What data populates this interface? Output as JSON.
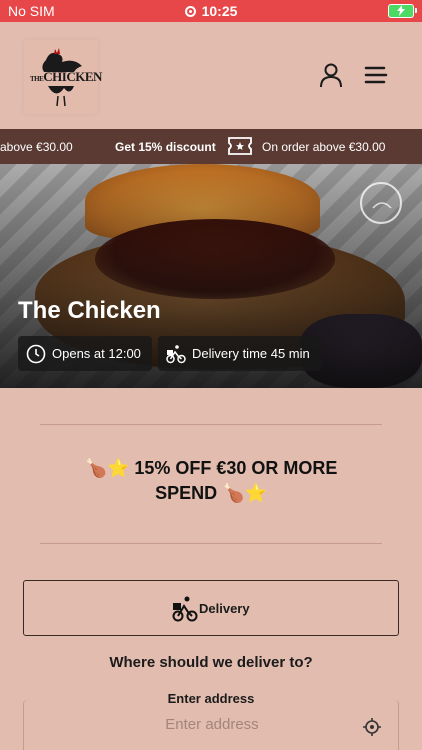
{
  "status_bar": {
    "carrier": "No SIM",
    "time": "10:25"
  },
  "header": {
    "logo_text_the": "THE",
    "logo_text_chicken": "CHICKEN"
  },
  "ticker": {
    "left_text": "above €30.00",
    "center_text": "Get 15% discount",
    "right_text": "On order above €30.00"
  },
  "hero": {
    "title": "The Chicken",
    "opens": "Opens at 12:00",
    "delivery_time": "Delivery time 45 min"
  },
  "promo": {
    "line1": "🍗⭐ 15% OFF €30 OR MORE",
    "line2": "SPEND 🍗⭐"
  },
  "order": {
    "delivery_label": "Delivery",
    "where_text": "Where should we deliver to?",
    "address_label": "Enter address",
    "address_placeholder": "Enter address"
  },
  "colors": {
    "status_bar": "#e8474a",
    "background": "#e2bcae",
    "ticker": "#5a3a33"
  }
}
